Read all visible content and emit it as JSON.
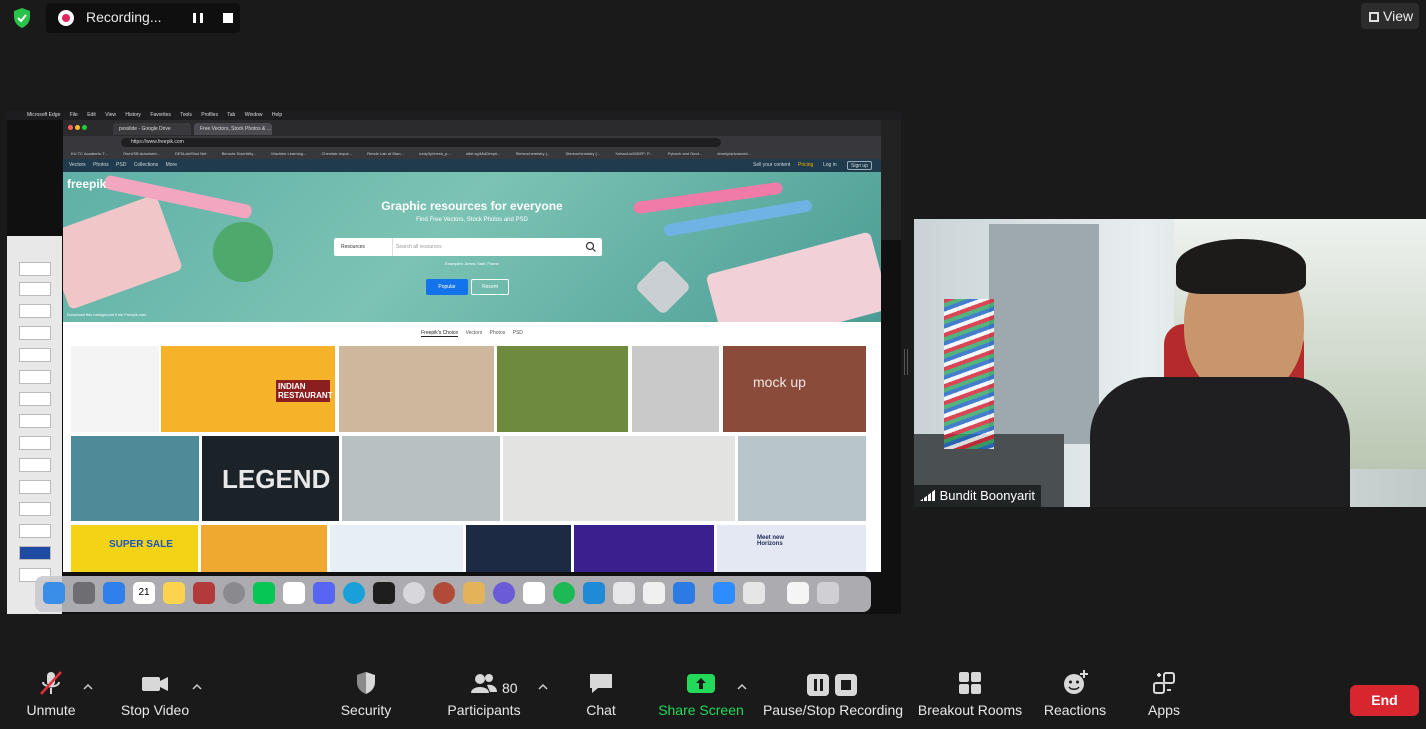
{
  "recording": {
    "status": "Recording..."
  },
  "view_label": "View",
  "shared_screen": {
    "menubar": [
      "Microsoft Edge",
      "File",
      "Edit",
      "View",
      "History",
      "Favorites",
      "Tools",
      "Profiles",
      "Tab",
      "Window",
      "Help"
    ],
    "tabs": [
      "pvsslide - Google Drive",
      "Free Vectors, Stock Photos & ..."
    ],
    "url": "https://www.freepik.com",
    "bookmarks": [
      "KU TC Academic T...",
      "OneUSB Autorised...",
      "DESLab/Stud Net",
      "Berouts Scientifiq...",
      "Machine Learning...",
      "Chemistr-Inquir...",
      "Rende Lab at Stan...",
      "runty3y/mesh_p...",
      "rdkit.sg/MolDrepri...",
      "Stereochemistry (...",
      "Stereochemistry (...",
      "XuhanLiu/MDEP: P...",
      "Pytorch and Geot...",
      "donnly/advanced..."
    ],
    "freepik": {
      "logo": "freepik",
      "nav": [
        "Vectors",
        "Photos",
        "PSD",
        "Collections",
        "More"
      ],
      "nav_right": [
        "Sell your content",
        "Pricing",
        "Log in",
        "Sign up"
      ],
      "hero_title": "Graphic resources for everyone",
      "hero_subtitle": "Find Free Vectors, Stock Photos and PSD",
      "search_category": "Resources",
      "search_placeholder": "Search all resources",
      "examples": "Examples: Arrow, Sale, Frame",
      "popular_label": "Popular",
      "recent_label": "Recent",
      "hero_credit": "Download this background from Freepik.com",
      "subtabs": [
        "Freepik's Choice",
        "Vectors",
        "Photos",
        "PSD"
      ],
      "tile_texts": [
        "LEGEND",
        "INDIAN RESTAURANT",
        "mock up",
        "SUPER SALE",
        "Meet new Horizons"
      ]
    }
  },
  "participant": {
    "name": "Bundit Boonyarit"
  },
  "toolbar": {
    "unmute": "Unmute",
    "stop_video": "Stop Video",
    "security": "Security",
    "participants": "Participants",
    "participants_count": "80",
    "chat": "Chat",
    "share_screen": "Share Screen",
    "pause_stop_recording": "Pause/Stop Recording",
    "breakout_rooms": "Breakout Rooms",
    "reactions": "Reactions",
    "apps": "Apps",
    "end": "End"
  },
  "colors": {
    "accent_green": "#23d959",
    "end_red": "#d8262e",
    "freepik_blue": "#1273eb"
  }
}
